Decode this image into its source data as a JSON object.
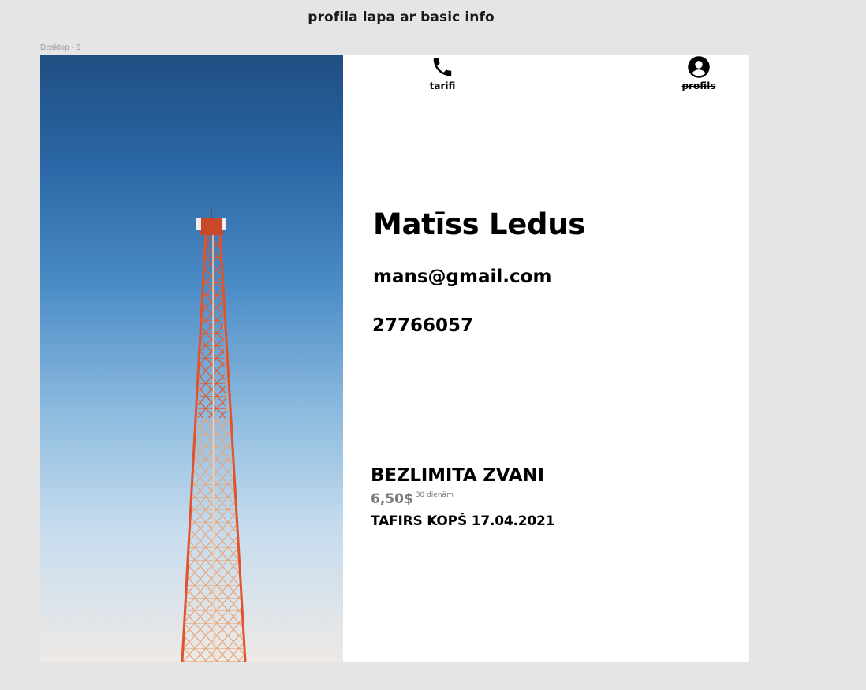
{
  "canvas": {
    "title": "profila lapa ar basic info",
    "frame_label": "Desktop - 5"
  },
  "nav": {
    "items": [
      {
        "label": "tarifi",
        "icon": "phone-icon"
      },
      {
        "label": "profils",
        "icon": "user-circle-icon"
      }
    ]
  },
  "profile": {
    "name": "Matīss Ledus",
    "email": "mans@gmail.com",
    "phone": "27766057"
  },
  "plan": {
    "title": "BEZLIMITA ZVANI",
    "price": "6,50$",
    "period": "30 dienām",
    "since": "TAFIRS KOPŠ 17.04.2021"
  },
  "colors": {
    "canvas_bg": "#e5e5e5",
    "frame_bg": "#ffffff",
    "sky_top": "#1f4f82",
    "sky_bottom": "#ede9e6",
    "tower_red": "#e0532b",
    "price_gray": "#7a7a7a"
  }
}
